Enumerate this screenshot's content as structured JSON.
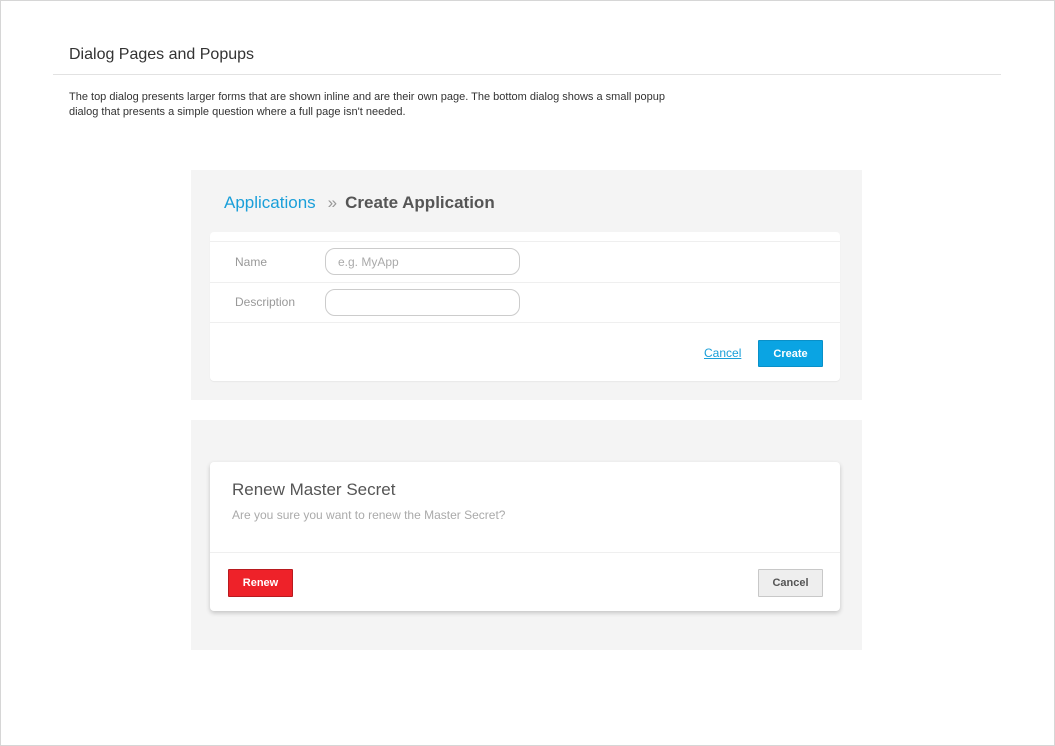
{
  "header": {
    "title": "Dialog Pages and Popups",
    "description": "The top dialog presents larger forms that are shown inline and are their own page. The bottom dialog shows a small popup dialog that presents a simple question where a full page isn't needed."
  },
  "form_dialog": {
    "breadcrumb": {
      "parent": "Applications",
      "separator": "»",
      "current": "Create Application"
    },
    "fields": [
      {
        "label": "Name",
        "value": "",
        "placeholder": "e.g. MyApp"
      },
      {
        "label": "Description",
        "value": "",
        "placeholder": ""
      }
    ],
    "cancel_label": "Cancel",
    "create_label": "Create"
  },
  "popup_dialog": {
    "title": "Renew Master Secret",
    "message": "Are you sure you want to renew the Master Secret?",
    "renew_label": "Renew",
    "cancel_label": "Cancel"
  },
  "colors": {
    "accent": "#1a9fd9",
    "danger": "#ee2229",
    "panel": "#f4f4f4"
  }
}
